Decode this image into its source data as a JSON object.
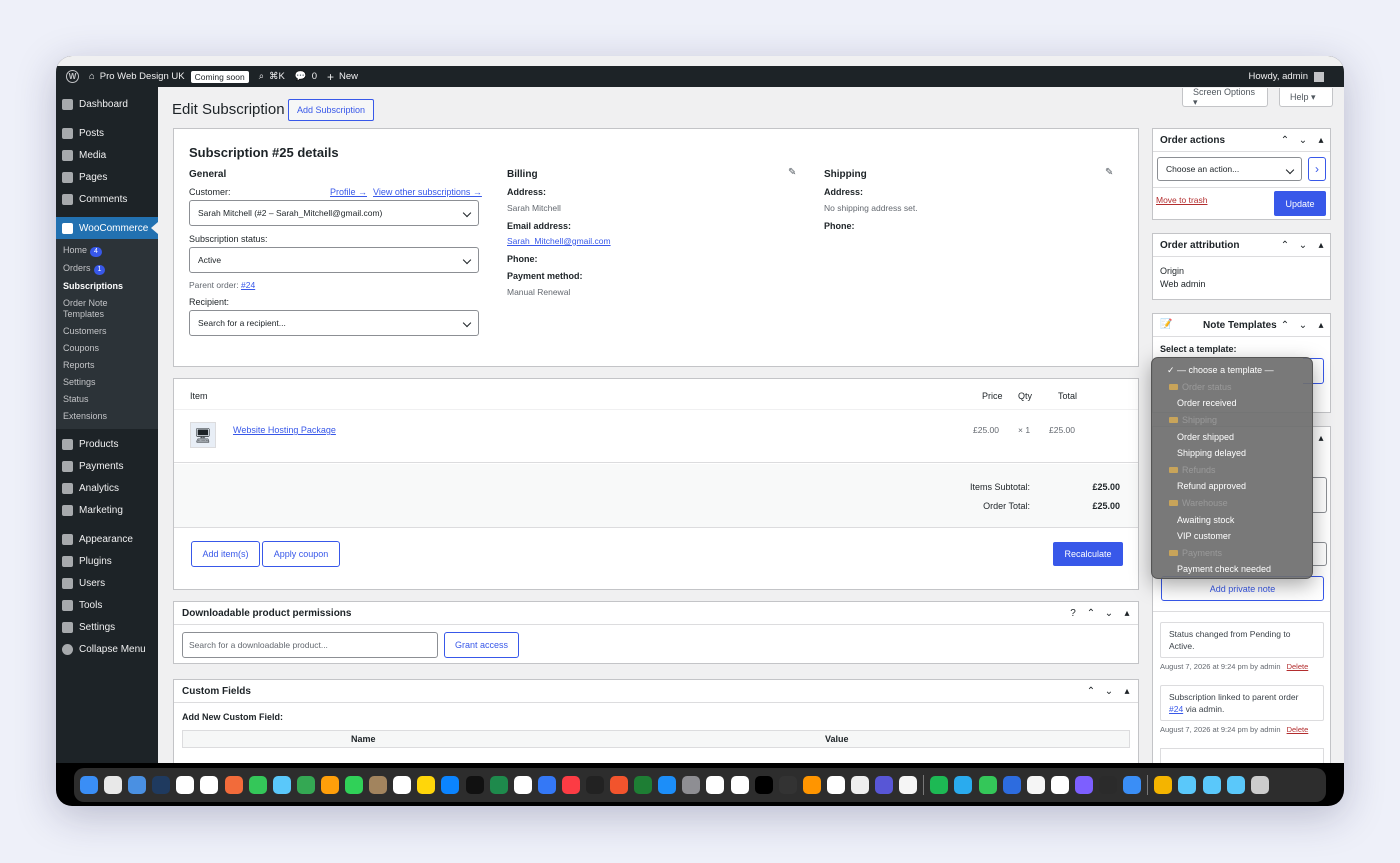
{
  "adminbar": {
    "site_name": "Pro Web Design UK",
    "coming_soon": "Coming soon",
    "shortcut": "⌘K",
    "comments_count": "0",
    "new_label": "New",
    "howdy": "Howdy, admin"
  },
  "sidebar": {
    "items": [
      {
        "label": "Dashboard",
        "icon": "dashboard-icon"
      },
      {
        "label": "Posts",
        "icon": "pin-icon"
      },
      {
        "label": "Media",
        "icon": "media-icon"
      },
      {
        "label": "Pages",
        "icon": "page-icon"
      },
      {
        "label": "Comments",
        "icon": "comment-icon"
      },
      {
        "label": "WooCommerce",
        "icon": "woo-icon"
      }
    ],
    "woo_sub": [
      {
        "label": "Home",
        "count": "4"
      },
      {
        "label": "Orders",
        "count": "1"
      },
      {
        "label": "Subscriptions"
      },
      {
        "label": "Order Note Templates"
      },
      {
        "label": "Customers"
      },
      {
        "label": "Coupons"
      },
      {
        "label": "Reports"
      },
      {
        "label": "Settings"
      },
      {
        "label": "Status"
      },
      {
        "label": "Extensions"
      }
    ],
    "lower": [
      {
        "label": "Products",
        "icon": "products-icon"
      },
      {
        "label": "Payments",
        "icon": "payments-icon"
      },
      {
        "label": "Analytics",
        "icon": "analytics-icon"
      },
      {
        "label": "Marketing",
        "icon": "megaphone-icon"
      },
      {
        "label": "Appearance",
        "icon": "brush-icon"
      },
      {
        "label": "Plugins",
        "icon": "plug-icon"
      },
      {
        "label": "Users",
        "icon": "user-icon"
      },
      {
        "label": "Tools",
        "icon": "wrench-icon"
      },
      {
        "label": "Settings",
        "icon": "settings-icon"
      },
      {
        "label": "Collapse Menu",
        "icon": "collapse-icon"
      }
    ]
  },
  "header": {
    "title": "Edit Subscription",
    "add_button": "Add Subscription",
    "screen_options": "Screen Options ▾",
    "help": "Help ▾"
  },
  "details": {
    "title": "Subscription #25 details",
    "general": "General",
    "customer_label": "Customer:",
    "profile_link": "Profile →",
    "other_subs_link": "View other subscriptions →",
    "customer_value": "Sarah Mitchell (#2 – Sarah_Mitchell@gmail.com)",
    "status_label": "Subscription status:",
    "status_value": "Active",
    "parent_label": "Parent order:",
    "parent_value": "#24",
    "recipient_label": "Recipient:",
    "recipient_placeholder": "Search for a recipient...",
    "billing": "Billing",
    "billing_address_label": "Address:",
    "billing_address": "Sarah Mitchell",
    "email_label": "Email address:",
    "email": "Sarah_Mitchell@gmail.com",
    "phone_label": "Phone:",
    "payment_label": "Payment method:",
    "payment_value": "Manual Renewal",
    "shipping": "Shipping",
    "shipping_address_label": "Address:",
    "shipping_address": "No shipping address set.",
    "shipping_phone_label": "Phone:"
  },
  "items": {
    "col_item": "Item",
    "col_price": "Price",
    "col_qty": "Qty",
    "col_total": "Total",
    "product": "Website Hosting Package",
    "price": "£25.00",
    "qty": "× 1",
    "total": "£25.00",
    "subtotal_label": "Items Subtotal:",
    "subtotal": "£25.00",
    "order_total_label": "Order Total:",
    "order_total": "£25.00",
    "add_items": "Add item(s)",
    "apply_coupon": "Apply coupon",
    "recalculate": "Recalculate"
  },
  "downloads": {
    "title": "Downloadable product permissions",
    "placeholder": "Search for a downloadable product...",
    "grant": "Grant access"
  },
  "custom_fields": {
    "title": "Custom Fields",
    "add_new": "Add New Custom Field:",
    "col_name": "Name",
    "col_value": "Value"
  },
  "order_actions": {
    "title": "Order actions",
    "select": "Choose an action...",
    "go": "›",
    "trash": "Move to trash",
    "update": "Update"
  },
  "attribution": {
    "title": "Order attribution",
    "origin_label": "Origin",
    "origin_value": "Web admin"
  },
  "note_templates": {
    "title": "Note Templates",
    "select_label": "Select a template:",
    "options": [
      {
        "label": "— choose a template —",
        "type": "selected"
      },
      {
        "label": "Order status",
        "type": "group"
      },
      {
        "label": "Order received",
        "type": "option"
      },
      {
        "label": "Shipping",
        "type": "group"
      },
      {
        "label": "Order shipped",
        "type": "option"
      },
      {
        "label": "Shipping delayed",
        "type": "option"
      },
      {
        "label": "Refunds",
        "type": "group"
      },
      {
        "label": "Refund approved",
        "type": "option"
      },
      {
        "label": "Warehouse",
        "type": "group"
      },
      {
        "label": "Awaiting stock",
        "type": "option"
      },
      {
        "label": "VIP customer",
        "type": "option"
      },
      {
        "label": "Payments",
        "type": "group"
      },
      {
        "label": "Payment check needed",
        "type": "option"
      }
    ]
  },
  "notes": {
    "add_private": "Add private note",
    "note1_text": "Status changed from Pending to Active.",
    "note1_meta": "August 7, 2026 at 9:24 pm by admin",
    "note2_text_a": "Subscription linked to parent order",
    "note2_link": "#24",
    "note2_text_b": "via admin.",
    "note2_meta": "August 7, 2026 at 9:24 pm by admin",
    "delete": "Delete"
  },
  "dock_colors": [
    "#3a8ef6",
    "#e8e8e8",
    "#4a90e2",
    "#1f3a5f",
    "#ffffff",
    "#ffffff",
    "#f26b3a",
    "#34c759",
    "#5ac8fa",
    "#34a853",
    "#ff9f0a",
    "#30d158",
    "#a2845e",
    "#ffffff",
    "#ffd60a",
    "#0b84ff",
    "#111111",
    "#1e8a4c",
    "#ffffff",
    "#3478f6",
    "#fc3c44",
    "#222222",
    "#f2542d",
    "#1e7e34",
    "#1c8ef9",
    "#8e8e93",
    "#ffffff",
    "#ffffff",
    "#000000",
    "#333333",
    "#ff9500",
    "#ffffff",
    "#eeeeee",
    "#5856d6",
    "#f5f5f5",
    "#1db954",
    "#2aabee",
    "#34c759",
    "#2d6cdf",
    "#f5f5f5",
    "#ffffff",
    "#7d5fff",
    "#2b2b2b",
    "#3a8ef6",
    "#f4b400",
    "#5ac8fa",
    "#5ac8fa",
    "#5ac8fa",
    "#cccccc"
  ]
}
